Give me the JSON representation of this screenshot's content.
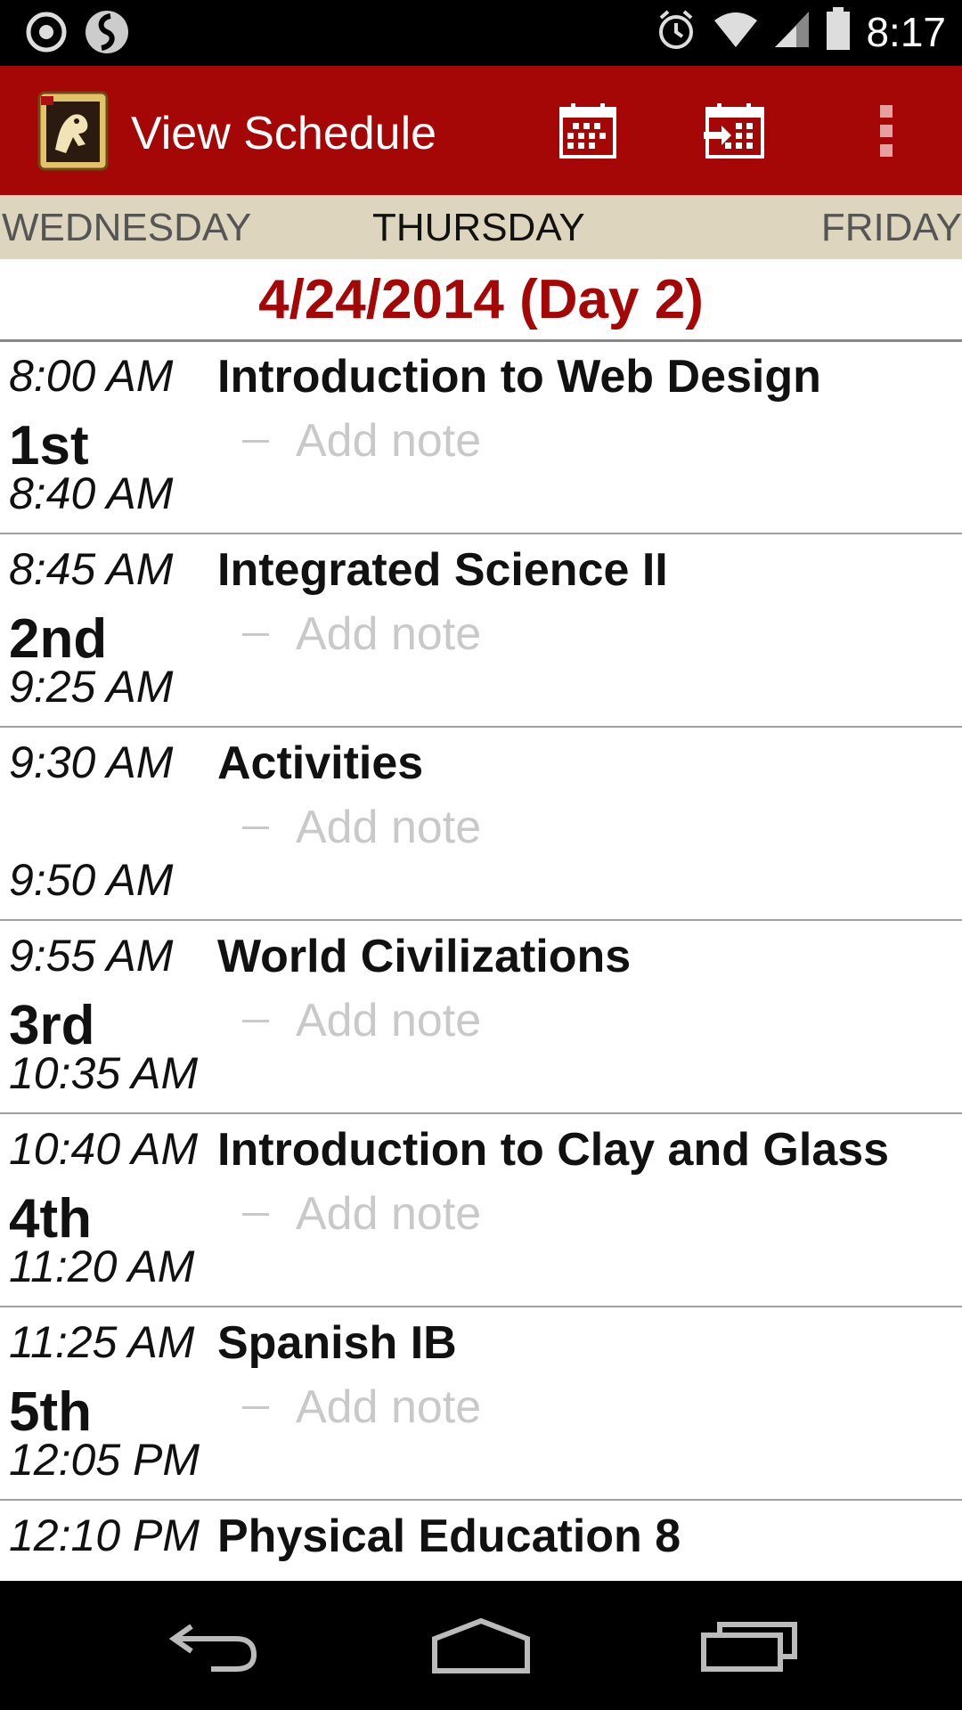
{
  "status_bar": {
    "time": "8:17"
  },
  "action_bar": {
    "title": "View Schedule"
  },
  "days": {
    "prev": "WEDNESDAY",
    "current": "THURSDAY",
    "next": "FRIDAY"
  },
  "date_heading": "4/24/2014 (Day 2)",
  "schedule": [
    {
      "start": "8:00 AM",
      "period": "1st",
      "end": "8:40 AM",
      "course": "Introduction to Web Design",
      "note": "Add note"
    },
    {
      "start": "8:45 AM",
      "period": "2nd",
      "end": "9:25 AM",
      "course": "Integrated Science II",
      "note": "Add note"
    },
    {
      "start": "9:30 AM",
      "period": "",
      "end": "9:50 AM",
      "course": "Activities",
      "note": "Add note"
    },
    {
      "start": "9:55 AM",
      "period": "3rd",
      "end": "10:35 AM",
      "course": "World Civilizations",
      "note": "Add note"
    },
    {
      "start": "10:40 AM",
      "period": "4th",
      "end": "11:20 AM",
      "course": "Introduction to Clay and Glass",
      "note": "Add note"
    },
    {
      "start": "11:25 AM",
      "period": "5th",
      "end": "12:05 PM",
      "course": "Spanish IB",
      "note": "Add note"
    },
    {
      "start": "12:10 PM",
      "period": "",
      "end": "",
      "course": "Physical Education 8",
      "note": ""
    }
  ],
  "colors": {
    "accent": "#a50606",
    "day_strip": "#ddd5bd",
    "note_text": "#c9c9c9"
  }
}
